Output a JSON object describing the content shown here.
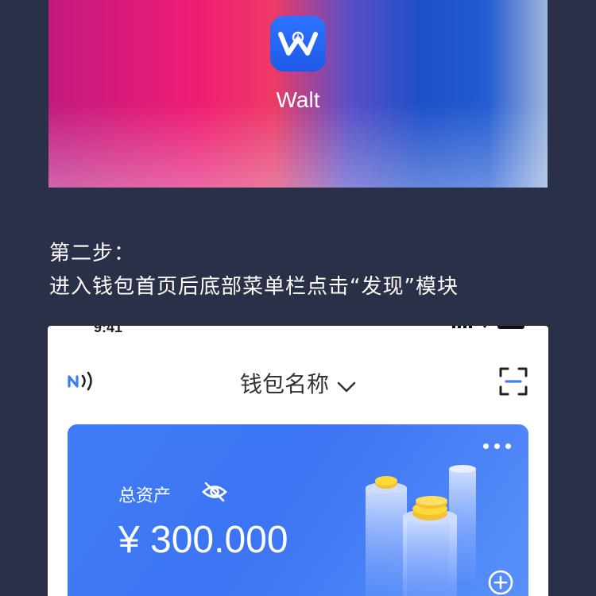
{
  "banner": {
    "app_name": "Walt",
    "icon": "walt-app-icon"
  },
  "instruction": {
    "line1": "第二步：",
    "line2": "进入钱包首页后底部菜单栏点击“发现”模块"
  },
  "phone": {
    "status_time": "9:41",
    "header": {
      "title": "钱包名称",
      "left_icon": "nfc-icon",
      "right_icon": "scan-icon",
      "dropdown_icon": "chevron-down-icon"
    },
    "card": {
      "asset_label": "总资产",
      "asset_value": "¥ 300.000",
      "visibility_icon": "eye-off-icon",
      "more_icon": "more-dots-icon",
      "add_icon": "plus-circle-icon"
    }
  },
  "colors": {
    "background": "#2a3048",
    "card_blue": "#3f7cf7",
    "app_icon_blue": "#2d73ff"
  }
}
